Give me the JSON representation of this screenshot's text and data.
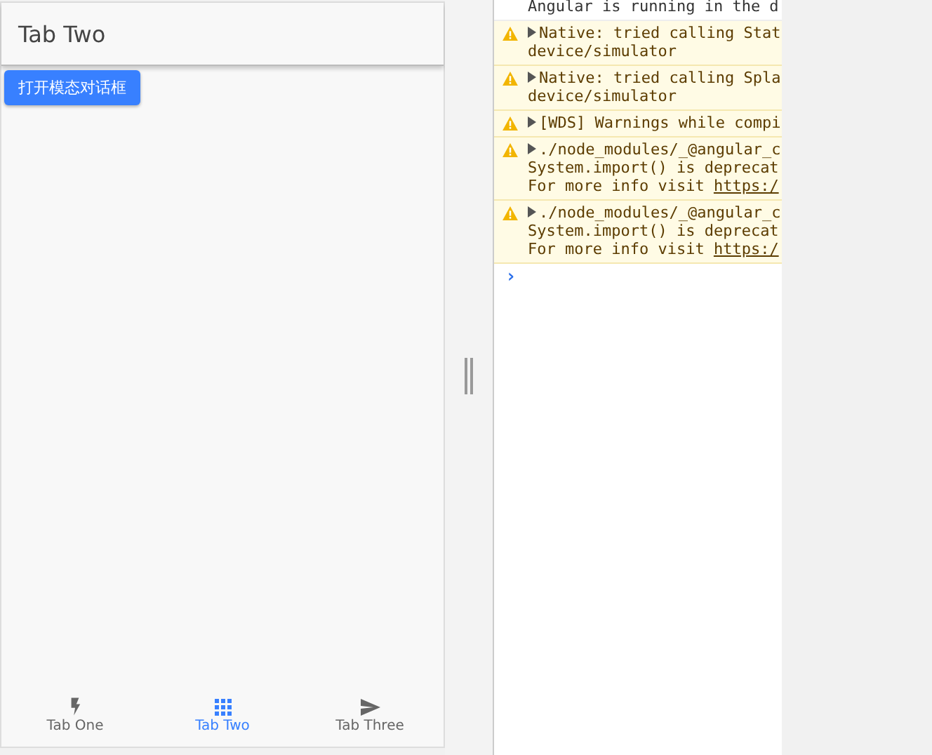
{
  "app": {
    "title": "Tab Two",
    "button": "打开模态对话框",
    "tabs": [
      {
        "label": "Tab One",
        "kind": "bolt",
        "selected": false
      },
      {
        "label": "Tab Two",
        "kind": "grid",
        "selected": true
      },
      {
        "label": "Tab Three",
        "kind": "send",
        "selected": false
      }
    ]
  },
  "console": {
    "entries": [
      {
        "kind": "info",
        "lines": [
          {
            "text": "Angular is running in the d"
          }
        ]
      },
      {
        "kind": "warning",
        "lines": [
          {
            "text": "Native: tried calling Stat"
          },
          {
            "text": "device/simulator"
          }
        ]
      },
      {
        "kind": "warning",
        "lines": [
          {
            "text": "Native: tried calling Spla"
          },
          {
            "text": "device/simulator"
          }
        ]
      },
      {
        "kind": "warning",
        "lines": [
          {
            "text": "[WDS] Warnings while compi"
          }
        ]
      },
      {
        "kind": "warning",
        "lines": [
          {
            "text": "./node_modules/_@angular_c"
          },
          {
            "text": "System.import() is deprecat"
          },
          {
            "text": "For more info visit ",
            "link": "https:/"
          }
        ]
      },
      {
        "kind": "warning",
        "lines": [
          {
            "text": "./node_modules/_@angular_c"
          },
          {
            "text": "System.import() is deprecat"
          },
          {
            "text": "For more info visit ",
            "link": "https:/"
          }
        ]
      }
    ],
    "prompt": "›"
  }
}
